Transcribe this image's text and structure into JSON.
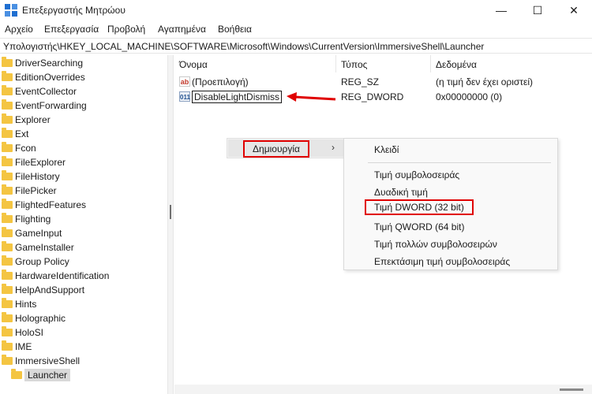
{
  "window": {
    "title": "Επεξεργαστής Μητρώου",
    "buttons": {
      "minimize": "—",
      "maximize": "☐",
      "close": "✕"
    }
  },
  "menubar": [
    "Αρχείο",
    "Επεξεργασία",
    "Προβολή",
    "Αγαπημένα",
    "Βοήθεια"
  ],
  "address": "Υπολογιστής\\HKEY_LOCAL_MACHINE\\SOFTWARE\\Microsoft\\Windows\\CurrentVersion\\ImmersiveShell\\Launcher",
  "tree": {
    "items": [
      "DriverSearching",
      "EditionOverrides",
      "EventCollector",
      "EventForwarding",
      "Explorer",
      "Ext",
      "Fcon",
      "FileExplorer",
      "FileHistory",
      "FilePicker",
      "FlightedFeatures",
      "Flighting",
      "GameInput",
      "GameInstaller",
      "Group Policy",
      "HardwareIdentification",
      "HelpAndSupport",
      "Hints",
      "Holographic",
      "HoloSI",
      "IME",
      "ImmersiveShell"
    ],
    "selected": "Launcher"
  },
  "list": {
    "columns": {
      "name": "Όνομα",
      "type": "Τύπος",
      "data": "Δεδομένα"
    },
    "rows": [
      {
        "icon": "string-value-icon",
        "icon_text": "ab",
        "name": "(Προεπιλογή)",
        "type": "REG_SZ",
        "data": "(η τιμή δεν έχει οριστεί)"
      },
      {
        "icon": "binary-value-icon",
        "icon_text": "011",
        "name": "DisableLightDismiss",
        "type": "REG_DWORD",
        "data": "0x00000000 (0)"
      }
    ]
  },
  "context_menu": {
    "new_label": "Δημιουργία",
    "submenu_arrow": "›",
    "submenu": {
      "key": "Κλειδί",
      "string_value": "Τιμή συμβολοσειράς",
      "binary_value": "Δυαδική τιμή",
      "dword_value": "Τιμή DWORD (32 bit)",
      "qword_value": "Τιμή QWORD (64 bit)",
      "multi_string_value": "Τιμή πολλών συμβολοσειρών",
      "expandable_string_value": "Επεκτάσιμη τιμή συμβολοσειράς"
    }
  },
  "colors": {
    "highlight_box": "#e00000",
    "folder": "#f4c542",
    "app_icon": "#1f6fd1"
  }
}
